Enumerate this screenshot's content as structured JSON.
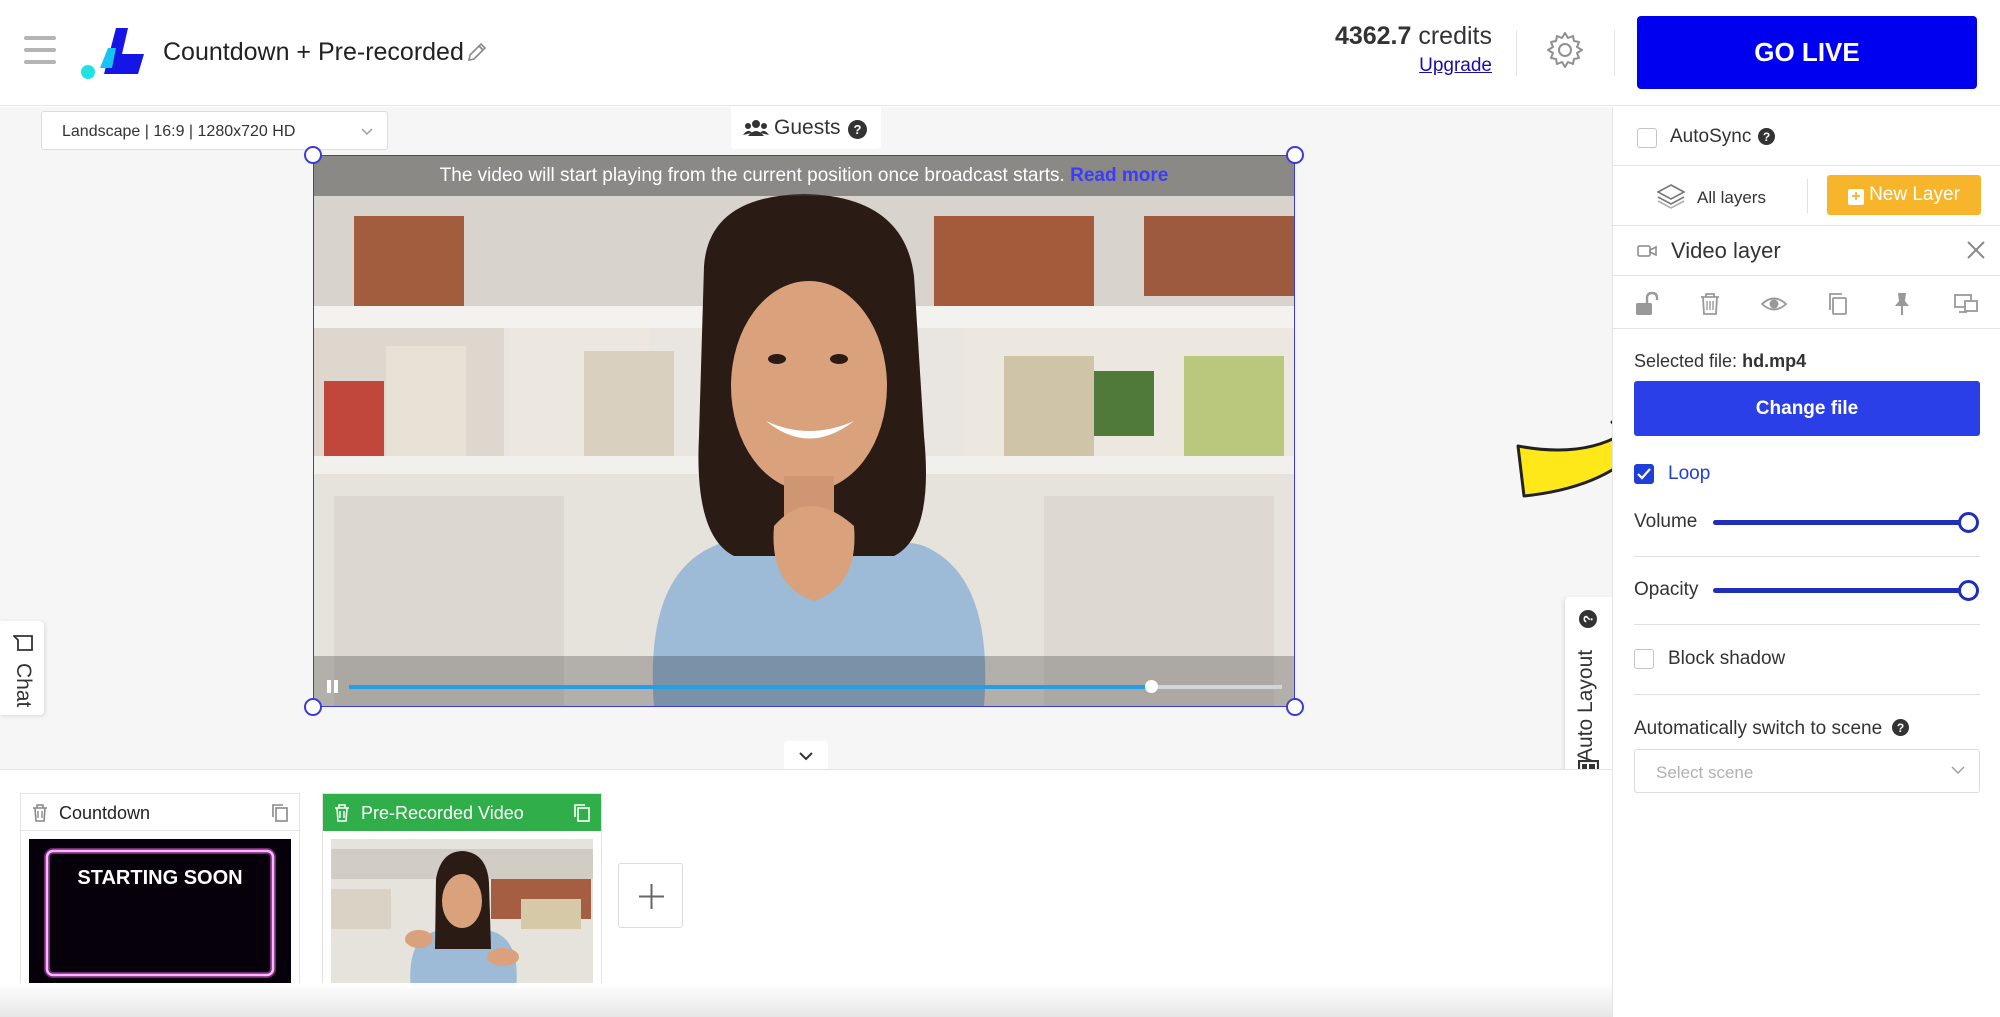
{
  "header": {
    "project_title": "Countdown + Pre-recorded",
    "credits_value": "4362.7",
    "credits_unit": "credits",
    "upgrade_label": "Upgrade",
    "go_live_label": "GO LIVE",
    "brand_color": "#0000f0"
  },
  "canvas": {
    "resolution": "Landscape | 16:9 | 1280x720 HD",
    "guests_label": "Guests",
    "notice_text": "The video will start playing from the current position once broadcast starts.",
    "read_more": "Read more",
    "video_progress": 0.86,
    "chat_label": "Chat",
    "auto_layout_label": "Auto Layout"
  },
  "scenes": [
    {
      "name": "Countdown",
      "active": false,
      "thumb_text": "STARTING SOON"
    },
    {
      "name": "Pre-Recorded Video",
      "active": true
    }
  ],
  "panel": {
    "autosync_label": "AutoSync",
    "autosync_checked": false,
    "all_layers_label": "All layers",
    "new_layer_label": "New Layer",
    "layer_title": "Video layer",
    "selected_file_prefix": "Selected file:",
    "selected_file_name": "hd.mp4",
    "change_file_label": "Change file",
    "loop_label": "Loop",
    "loop_checked": true,
    "volume_label": "Volume",
    "volume_value": 1.0,
    "opacity_label": "Opacity",
    "opacity_value": 1.0,
    "block_shadow_label": "Block shadow",
    "block_shadow_checked": false,
    "auto_switch_label": "Automatically switch to scene",
    "scene_select_placeholder": "Select scene",
    "tool_icons": [
      "unlock-icon",
      "trash-icon",
      "eye-icon",
      "copy-icon",
      "pin-icon",
      "screens-icon"
    ]
  }
}
